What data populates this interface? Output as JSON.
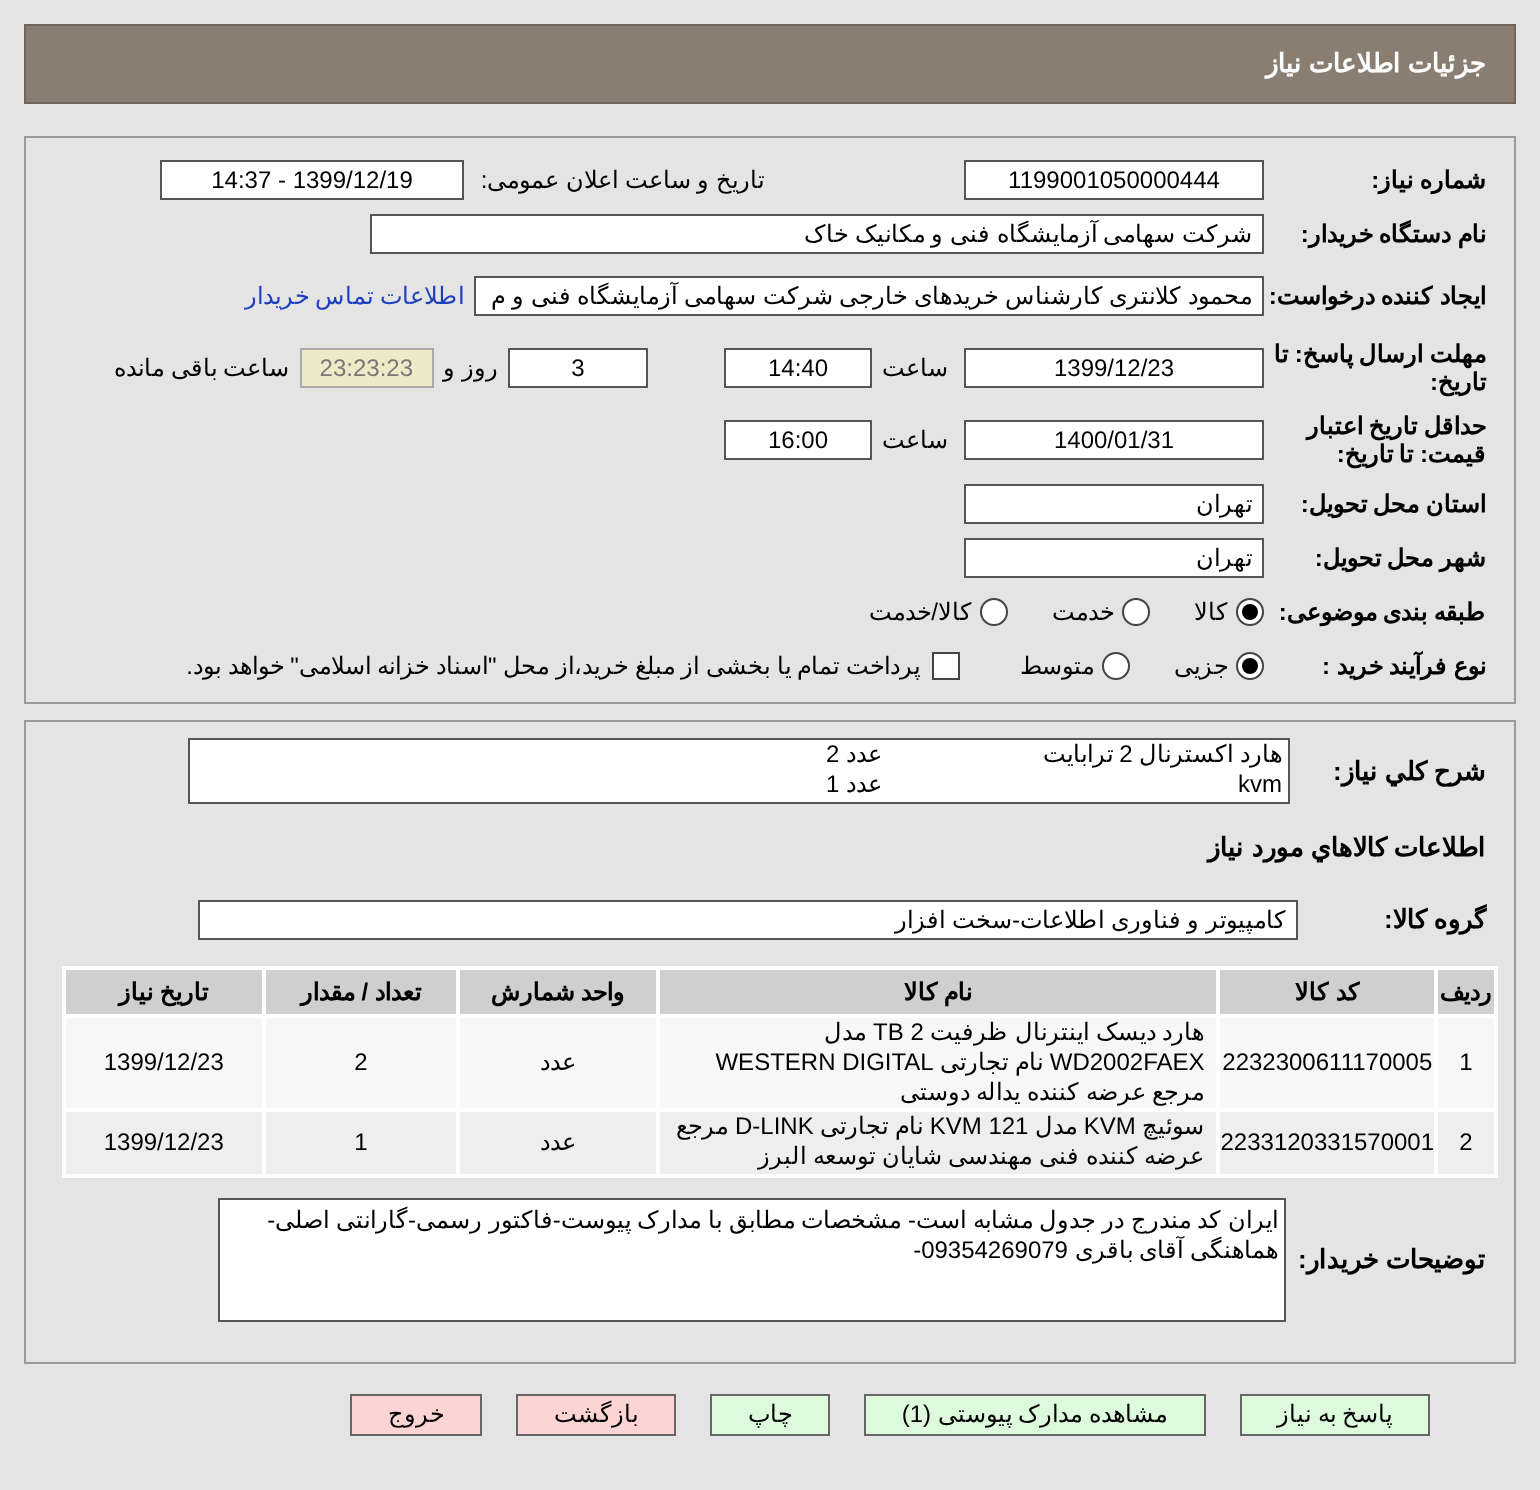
{
  "header": {
    "title": "جزئیات اطلاعات نیاز"
  },
  "details": {
    "need_number": {
      "label": "شماره نیاز:",
      "value": "1199001050000444"
    },
    "announce": {
      "label": "تاریخ و ساعت اعلان عمومی:",
      "value": "1399/12/19 - 14:37"
    },
    "buyer": {
      "label": "نام دستگاه خریدار:",
      "value": "شرکت سهامی آزمایشگاه فنی و مکانیک خاک"
    },
    "creator": {
      "label": "ایجاد کننده درخواست:",
      "value": "محمود کلانتری کارشناس خریدهای خارجی  شرکت سهامی آزمایشگاه فنی و م",
      "link": "اطلاعات تماس خریدار"
    },
    "deadline": {
      "label": "مهلت ارسال پاسخ: تا تاریخ:",
      "date": "1399/12/23",
      "time_label": "ساعت",
      "time": "14:40",
      "days": "3",
      "days_label": "روز و",
      "remaining": "23:23:23",
      "remaining_label": "ساعت باقی مانده"
    },
    "validity": {
      "label": "حداقل تاریخ اعتبار قیمت: تا تاریخ:",
      "date": "1400/01/31",
      "time_label": "ساعت",
      "time": "16:00"
    },
    "province": {
      "label": "استان محل تحویل:",
      "value": "تهران"
    },
    "city": {
      "label": "شهر محل تحویل:",
      "value": "تهران"
    },
    "category": {
      "label": "طبقه بندی موضوعی:",
      "options": [
        {
          "label": "کالا",
          "selected": true
        },
        {
          "label": "خدمت",
          "selected": false
        },
        {
          "label": "کالا/خدمت",
          "selected": false
        }
      ]
    },
    "process": {
      "label": "نوع فرآیند خرید :",
      "options": [
        {
          "label": "جزیی",
          "selected": true
        },
        {
          "label": "متوسط",
          "selected": false
        }
      ],
      "treasury": {
        "label": "پرداخت تمام یا بخشی از مبلغ خرید،از محل \"اسناد خزانه اسلامی\" خواهد بود.",
        "checked": false
      }
    }
  },
  "summary": {
    "label": "شرح کلي نياز:",
    "lines": [
      {
        "item": "هارد اکسترنال 2 ترابایت",
        "qty": "عدد 2"
      },
      {
        "item": "kvm",
        "qty": "عدد 1"
      }
    ]
  },
  "goods": {
    "heading": "اطلاعات کالاهاي مورد نياز",
    "group_label": "گروه کالا:",
    "group": "کامپیوتر و فناوری اطلاعات-سخت افزار",
    "table": {
      "columns": [
        "ردیف",
        "کد کالا",
        "نام کالا",
        "واحد شمارش",
        "تعداد / مقدار",
        "تاریخ نیاز"
      ],
      "rows": [
        [
          "1",
          "2232300611170005",
          "هارد دیسک اینترنال ظرفیت 2 TB مدل WD2002FAEX نام تجارتی WESTERN DIGITAL مرجع عرضه کننده یداله دوستی",
          "عدد",
          "2",
          "1399/12/23"
        ],
        [
          "2",
          "2233120331570001",
          "سوئیچ KVM مدل KVM 121 نام تجارتی D-LINK مرجع عرضه کننده فنی مهندسی شایان توسعه البرز",
          "عدد",
          "1",
          "1399/12/23"
        ]
      ]
    }
  },
  "notes": {
    "label": "توضیحات خریدار:",
    "value": "ایران کد مندرج در جدول مشابه است- مشخصات مطابق با مدارک پیوست-فاکتور رسمی-گارانتی اصلی-هماهنگی آقای باقری 09354269079-"
  },
  "buttons": [
    {
      "label": "پاسخ به نیاز",
      "kind": "primary"
    },
    {
      "label": "مشاهده مدارک پیوستی (1)",
      "kind": "primary"
    },
    {
      "label": "چاپ",
      "kind": "primary"
    },
    {
      "label": "بازگشت",
      "kind": "danger"
    },
    {
      "label": "خروج",
      "kind": "danger"
    }
  ]
}
